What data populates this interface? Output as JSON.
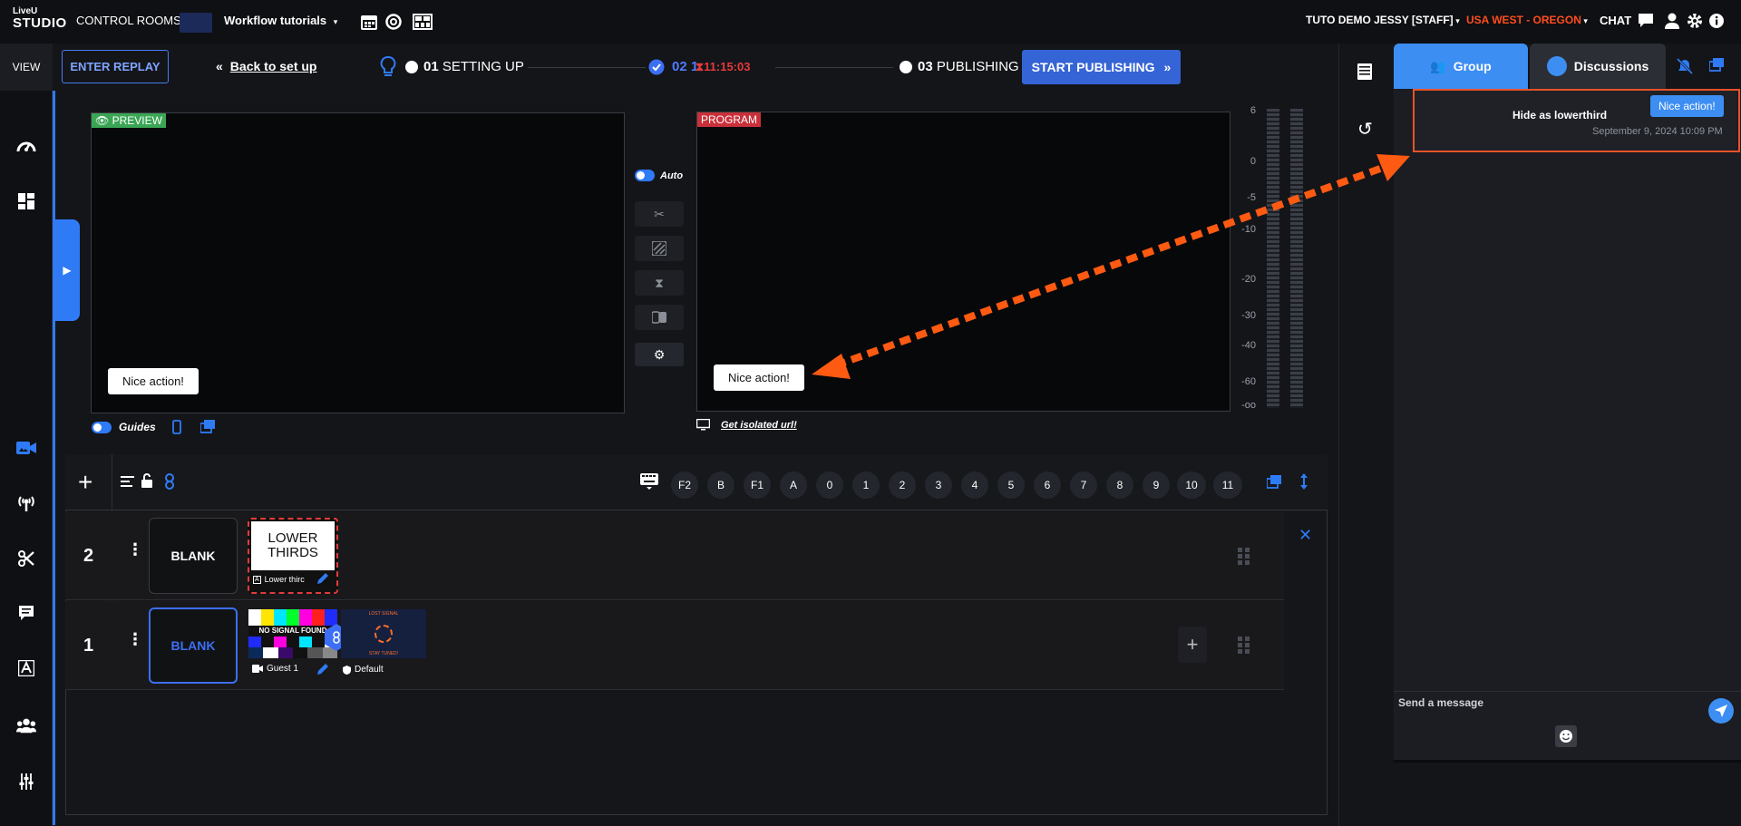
{
  "app": {
    "logo_top": "LiveU",
    "logo_main": "STUDIO",
    "nav_control_rooms": "CONTROL ROOMS",
    "nav_project": "Workflow tutorials",
    "user": "TUTO DEMO JESSY [STAFF]",
    "region": "USA WEST - OREGON",
    "chat_label": "CHAT"
  },
  "sidebar": {
    "view_label": "VIEW",
    "icons": [
      "dashboard-icon",
      "layout-icon",
      "video-icon",
      "broadcast-icon",
      "scissors-icon",
      "message-icon",
      "text-icon",
      "users-icon",
      "sliders-icon"
    ]
  },
  "toolbar": {
    "enter_replay": "ENTER REPLAY",
    "back_to_setup": "Back to set up",
    "step1_num": "01",
    "step1_label": "SETTING UP",
    "step2_num": "02 1",
    "step2_timer": "11:15:03",
    "step3_num": "03",
    "step3_label": "PUBLISHING",
    "start_publishing": "START PUBLISHING"
  },
  "preview": {
    "tag": "PREVIEW",
    "toast": "Nice action!",
    "guides_label": "Guides"
  },
  "program": {
    "tag": "PROGRAM",
    "toast": "Nice action!",
    "isolated_link": "Get isolated url!"
  },
  "controls": {
    "auto_label": "Auto"
  },
  "meter": {
    "labels": [
      "6",
      "0",
      "-5",
      "-10",
      "-20",
      "-30",
      "-40",
      "-60",
      "-oo"
    ]
  },
  "rundown": {
    "keys": [
      "F2",
      "B",
      "F1",
      "A",
      "0",
      "1",
      "2",
      "3",
      "4",
      "5",
      "6",
      "7",
      "8",
      "9",
      "10",
      "11"
    ],
    "rows": [
      {
        "number": "2",
        "blank": "BLANK",
        "card_title_1": "LOWER",
        "card_title_2": "THIRDS",
        "card_caption": "Lower thirc"
      },
      {
        "number": "1",
        "blank": "BLANK",
        "source_caption": "Guest 1",
        "preset_caption": "Default",
        "nosignal": "NO SIGNAL FOUND",
        "lost_signal": "LOST SIGNAL",
        "stay_tuned": "STAY TUNED!"
      }
    ]
  },
  "chat": {
    "tab_group": "Group",
    "tab_discussions": "Discussions",
    "message_title": "Hide as lowerthird",
    "message_time": "September 9, 2024 10:09 PM",
    "message_pill": "Nice action!",
    "input_placeholder": "Send a message"
  },
  "colors": {
    "accent": "#2f7bf6",
    "program_red": "#c9303a",
    "preview_green": "#3aa655",
    "annotation_orange": "#ff5a12",
    "highlight_box": "#e8522a"
  }
}
